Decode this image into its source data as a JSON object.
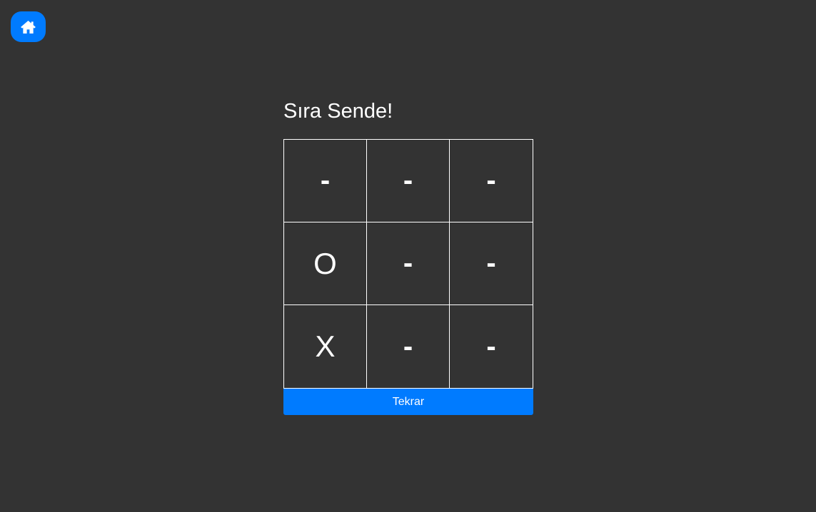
{
  "nav": {
    "home_icon": "home-icon",
    "accent": "#007bff"
  },
  "game": {
    "status": "Sıra Sende!",
    "board": [
      [
        "-",
        "-",
        "-"
      ],
      [
        "O",
        "-",
        "-"
      ],
      [
        "X",
        "-",
        "-"
      ]
    ],
    "restart_label": "Tekrar"
  },
  "colors": {
    "background": "#333333",
    "grid": "#ffffff",
    "button": "#007bff"
  }
}
